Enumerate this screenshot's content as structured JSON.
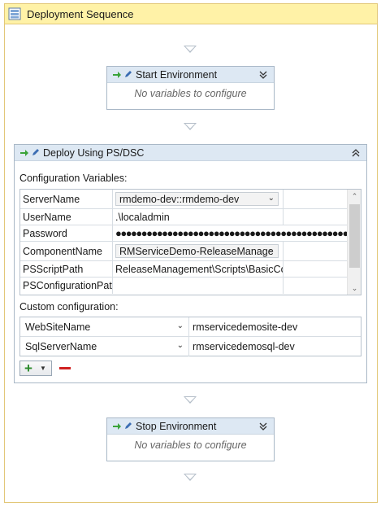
{
  "sequence": {
    "title": "Deployment Sequence"
  },
  "start_env": {
    "title": "Start Environment",
    "empty_text": "No variables to configure"
  },
  "deploy": {
    "title": "Deploy Using PS/DSC",
    "config_label": "Configuration Variables:",
    "variables": [
      {
        "name": "ServerName",
        "value": "rmdemo-dev::rmdemo-dev",
        "type": "combo"
      },
      {
        "name": "UserName",
        "value": ".\\localadmin",
        "type": "text"
      },
      {
        "name": "Password",
        "value": "●●●●●●●●●●●●●●●●●●●●●●●●●●●●●●●●●●●●●●●●●●●●●●●●",
        "type": "password"
      },
      {
        "name": "ComponentName",
        "value": "RMServiceDemo-ReleaseManage",
        "type": "combo"
      },
      {
        "name": "PSScriptPath",
        "value": "ReleaseManagement\\Scripts\\BasicCop",
        "type": "text"
      },
      {
        "name": "PSConfigurationPath",
        "value": "",
        "type": "text"
      }
    ],
    "custom_label": "Custom configuration:",
    "custom": [
      {
        "name": "WebSiteName",
        "value": "rmservicedemosite-dev"
      },
      {
        "name": "SqlServerName",
        "value": "rmservicedemosql-dev"
      }
    ],
    "add_label": "+",
    "remove_label": "−"
  },
  "stop_env": {
    "title": "Stop Environment",
    "empty_text": "No variables to configure"
  },
  "colors": {
    "header_yellow": "#fff2a7",
    "activity_header": "#dde8f3",
    "add_green": "#2a8a2a",
    "remove_red": "#d02020"
  }
}
